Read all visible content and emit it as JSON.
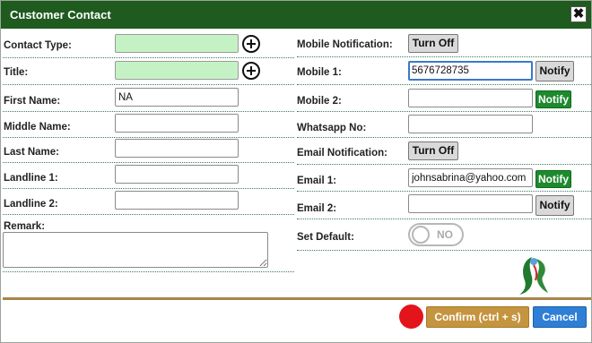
{
  "dialog": {
    "title": "Customer Contact",
    "close_glyph": "✖"
  },
  "left": {
    "contact_type": {
      "label": "Contact Type:",
      "value": ""
    },
    "title": {
      "label": "Title:",
      "value": ""
    },
    "first_name": {
      "label": "First Name:",
      "value": "NA"
    },
    "middle_name": {
      "label": "Middle Name:",
      "value": ""
    },
    "last_name": {
      "label": "Last Name:",
      "value": ""
    },
    "landline1": {
      "label": "Landline 1:",
      "value": ""
    },
    "landline2": {
      "label": "Landline 2:",
      "value": ""
    },
    "remark": {
      "label": "Remark:",
      "value": ""
    }
  },
  "right": {
    "mobile_notification": {
      "label": "Mobile Notification:",
      "button": "Turn Off"
    },
    "mobile1": {
      "label": "Mobile 1:",
      "value": "5676728735",
      "button": "Notify"
    },
    "mobile2": {
      "label": "Mobile 2:",
      "value": "",
      "button": "Notify"
    },
    "whatsapp": {
      "label": "Whatsapp No:",
      "value": ""
    },
    "email_notification": {
      "label": "Email Notification:",
      "button": "Turn Off"
    },
    "email1": {
      "label": "Email 1:",
      "value": "johnsabrina@yahoo.com",
      "button": "Notify"
    },
    "email2": {
      "label": "Email 2:",
      "value": "",
      "button": "Notify"
    },
    "set_default": {
      "label": "Set Default:",
      "toggle": "NO"
    }
  },
  "footer": {
    "confirm": "Confirm (ctrl + s)",
    "cancel": "Cancel"
  },
  "colors": {
    "title_bar": "#1f5a1f",
    "input_highlight": "#c5f2c5",
    "notify_green": "#1e8a2e",
    "confirm": "#c5943f",
    "cancel": "#2f7fd6",
    "status_dot": "#e3141b"
  },
  "icons": {
    "close": "close-icon",
    "add": "plus-circle-icon",
    "status": "red-dot-icon",
    "logo": "brand-logo-icon"
  }
}
